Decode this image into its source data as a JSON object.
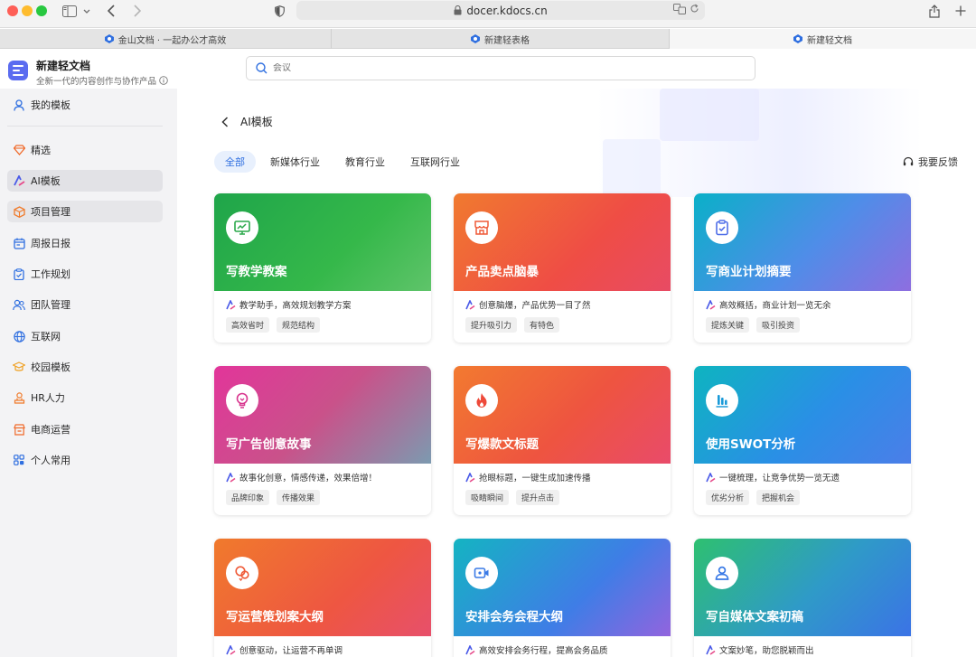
{
  "browser": {
    "url": "docer.kdocs.cn",
    "tabs": [
      {
        "label": "金山文档 · 一起办公才高效",
        "active": false
      },
      {
        "label": "新建轻表格",
        "active": false
      },
      {
        "label": "新建轻文档",
        "active": true
      }
    ]
  },
  "app": {
    "title": "新建轻文档",
    "subtitle": "全新一代的内容创作与协作产品",
    "search_placeholder": "会议"
  },
  "sidebar": {
    "items": [
      {
        "label": "我的模板",
        "icon": "user-icon",
        "color": "#2f6fe0"
      },
      {
        "label": "精选",
        "icon": "diamond-icon",
        "color": "#f06a2a"
      },
      {
        "label": "AI模板",
        "icon": "ai-icon",
        "color": "#4a5ae8"
      },
      {
        "label": "项目管理",
        "icon": "cube-icon",
        "color": "#f07a2a"
      },
      {
        "label": "周报日报",
        "icon": "calendar-icon",
        "color": "#2f6fe0"
      },
      {
        "label": "工作规划",
        "icon": "clipboard-icon",
        "color": "#2f6fe0"
      },
      {
        "label": "团队管理",
        "icon": "team-icon",
        "color": "#2f6fe0"
      },
      {
        "label": "互联网",
        "icon": "globe-icon",
        "color": "#2f6fe0"
      },
      {
        "label": "校园模板",
        "icon": "graduation-cap-icon",
        "color": "#f0a020"
      },
      {
        "label": "HR人力",
        "icon": "hr-icon",
        "color": "#f07a2a"
      },
      {
        "label": "电商运营",
        "icon": "shop-icon",
        "color": "#f06a2a"
      },
      {
        "label": "个人常用",
        "icon": "grid-icon",
        "color": "#2f6fe0"
      }
    ]
  },
  "main": {
    "page_title": "AI模板",
    "filters": [
      "全部",
      "新媒体行业",
      "教育行业",
      "互联网行业"
    ],
    "feedback_label": "我要反馈",
    "cards": [
      {
        "title": "写教学教案",
        "desc": "教学助手，高效规划教学方案",
        "tags": [
          "高效省时",
          "规范结构"
        ],
        "icon": "teaching-icon",
        "icon_color": "#2aa84a"
      },
      {
        "title": "产品卖点脑暴",
        "desc": "创意脑爆，产品优势一目了然",
        "tags": [
          "提升吸引力",
          "有特色"
        ],
        "icon": "store-icon",
        "icon_color": "#ef5a38"
      },
      {
        "title": "写商业计划摘要",
        "desc": "高效概括，商业计划一览无余",
        "tags": [
          "提炼关键",
          "吸引投资"
        ],
        "icon": "clipboard-check-icon",
        "icon_color": "#4f6ee8"
      },
      {
        "title": "写广告创意故事",
        "desc": "故事化创意，情感传递，效果倍增！",
        "tags": [
          "品牌印象",
          "传播效果"
        ],
        "icon": "lightbulb-icon",
        "icon_color": "#d8358e"
      },
      {
        "title": "写爆款文标题",
        "desc": "抢眼标题，一键生成加速传播",
        "tags": [
          "吸睛瞬间",
          "提升点击"
        ],
        "icon": "flame-icon",
        "icon_color": "#ee4a3a"
      },
      {
        "title": "使用SWOT分析",
        "desc": "一键梳理，让竞争优势一览无遗",
        "tags": [
          "优劣分析",
          "把握机会"
        ],
        "icon": "bar-chart-icon",
        "icon_color": "#1a9ad8"
      },
      {
        "title": "写运营策划案大纲",
        "desc": "创意驱动，让运营不再单调",
        "tags": [],
        "icon": "planning-icon",
        "icon_color": "#ef5a38"
      },
      {
        "title": "安排会务会程大纲",
        "desc": "高效安排会务行程，提高会务品质",
        "tags": [],
        "icon": "video-icon",
        "icon_color": "#3a7ae6"
      },
      {
        "title": "写自媒体文案初稿",
        "desc": "文案妙笔，助您脱颖而出",
        "tags": [],
        "icon": "person-icon",
        "icon_color": "#3a7ae6"
      }
    ]
  }
}
